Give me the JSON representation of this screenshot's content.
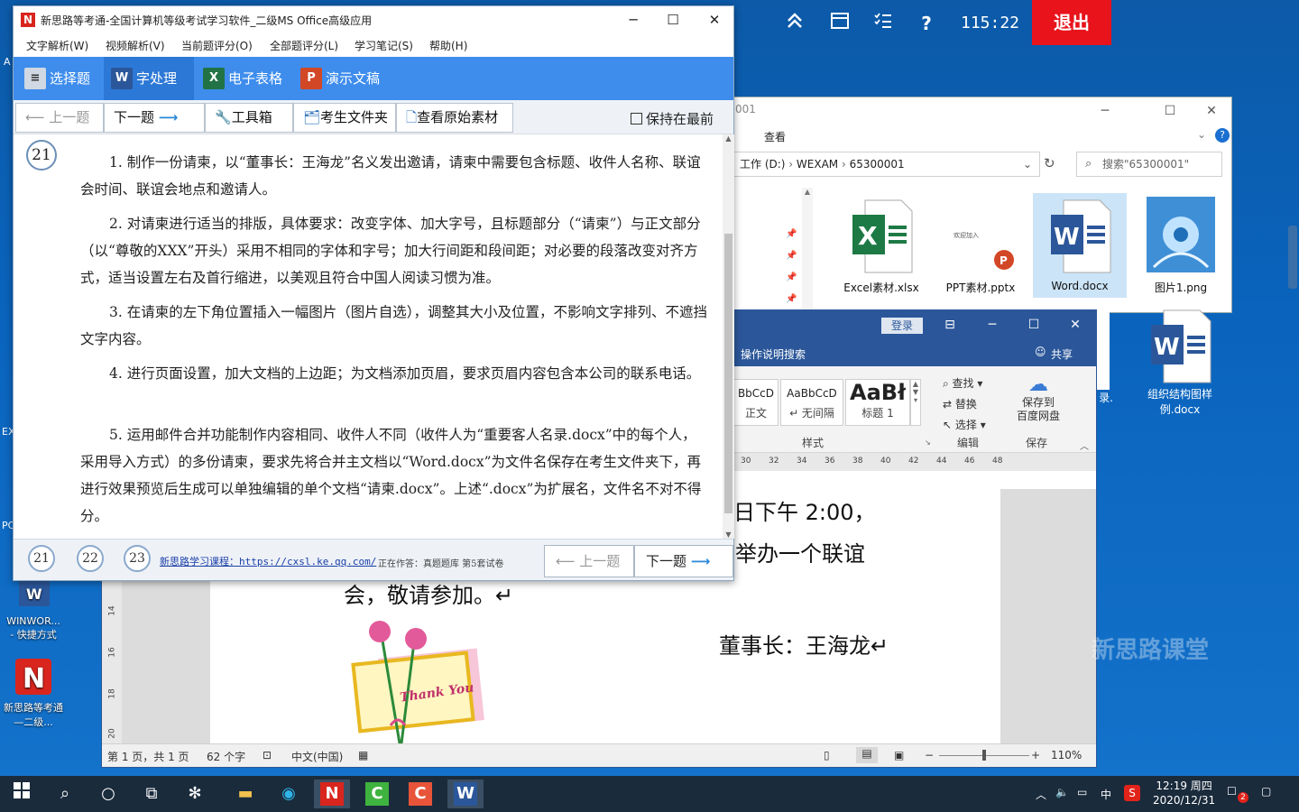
{
  "topbar": {
    "timer": "115:22",
    "exit_label": "退出",
    "help_glyph": "?"
  },
  "desktop": {
    "icons": [
      {
        "label": "WINWOR...\n- 快捷方式"
      },
      {
        "label": "新思路等考通—二级..."
      }
    ],
    "edge_labels": [
      "A",
      "EX",
      "PC"
    ]
  },
  "explorer": {
    "title_partial": "001",
    "ribbon_tab": "查看",
    "breadcrumb": [
      "工作 (D:)",
      "WEXAM",
      "65300001"
    ],
    "search_placeholder": "搜索\"65300001\"",
    "files": [
      {
        "name": "Excel素材.xlsx"
      },
      {
        "name": "PPT素材.pptx",
        "thumb_caption": "欢迎加入"
      },
      {
        "name": "Word.docx"
      },
      {
        "name": "图片1.png"
      }
    ],
    "extra_files": [
      {
        "name": "组织结构图样例.docx"
      },
      {
        "name": "录."
      }
    ]
  },
  "word": {
    "login_label": "登录",
    "tell_me": "操作说明搜索",
    "share_label": "共享",
    "styles": [
      {
        "preview": "BbCcD",
        "name": "正文"
      },
      {
        "preview": "AaBbCcD",
        "name": "↵ 无间隔"
      },
      {
        "preview": "AaBł",
        "name": "标题 1"
      }
    ],
    "styles_group": "样式",
    "edit_items": [
      "查找",
      "替换",
      "选择"
    ],
    "edit_group": "编辑",
    "save_label": "保存到\n百度网盘",
    "save_group": "保存",
    "ruler_marks": [
      "30",
      "32",
      "34",
      "36",
      "38",
      "40",
      "42",
      "44",
      "46",
      "48"
    ],
    "vruler_marks": [
      "14",
      "16",
      "18",
      "20"
    ],
    "doc_lines": [
      "日下午 2:00，",
      "举办一个联谊",
      "会，敬请参加。↵",
      "董事长：王海龙↵"
    ],
    "card_text": "Thank You",
    "status": {
      "page": "第 1 页，共 1 页",
      "words": "62 个字",
      "lang": "中文(中国)",
      "zoom": "110%"
    }
  },
  "exam": {
    "title": "新思路等考通-全国计算机等级考试学习软件_二级MS Office高级应用",
    "menu": [
      "文字解析(W)",
      "视频解析(V)",
      "当前题评分(O)",
      "全部题评分(L)",
      "学习笔记(S)",
      "帮助(H)"
    ],
    "tabs": [
      {
        "label": "选择题",
        "icon": "≡",
        "color": "#cfd8e3"
      },
      {
        "label": "字处理",
        "icon": "W",
        "color": "#2b579a"
      },
      {
        "label": "电子表格",
        "icon": "X",
        "color": "#217346"
      },
      {
        "label": "演示文稿",
        "icon": "P",
        "color": "#d24726"
      }
    ],
    "tools": {
      "prev": "上一题",
      "next": "下一题",
      "toolbox": "工具箱",
      "folder": "考生文件夹",
      "original": "查看原始素材",
      "keep_top": "保持在最前"
    },
    "question_number": "21",
    "paragraphs": [
      "1. 制作一份请柬，以“董事长：王海龙”名义发出邀请，请柬中需要包含标题、收件人名称、联谊会时间、联谊会地点和邀请人。",
      "2. 对请柬进行适当的排版，具体要求：改变字体、加大字号，且标题部分（“请柬”）与正文部分（以“尊敬的XXX”开头）采用不相同的字体和字号；加大行间距和段间距；对必要的段落改变对齐方式，适当设置左右及首行缩进，以美观且符合中国人阅读习惯为准。",
      "3. 在请柬的左下角位置插入一幅图片（图片自选），调整其大小及位置，不影响文字排列、不遮挡文字内容。",
      "4. 进行页面设置，加大文档的上边距；为文档添加页眉，要求页眉内容包含本公司的联系电话。",
      "5. 运用邮件合并功能制作内容相同、收件人不同（收件人为“重要客人名录.docx”中的每个人，采用导入方式）的多份请柬，要求先将合并主文档以“Word.docx”为文件名保存在考生文件夹下，再进行效果预览后生成可以单独编辑的单个文档“请柬.docx”。上述“.docx”为扩展名，文件名不对不得分。"
    ],
    "footer": {
      "pages": [
        "21",
        "22",
        "23"
      ],
      "link": "新思路学习课程：https://cxsl.ke.qq.com/",
      "status": "正在作答：真题题库 第5套试卷",
      "prev": "上一题",
      "next": "下一题"
    }
  },
  "watermark": "新思路课堂",
  "taskbar": {
    "time": "12:19 周四",
    "date": "2020/12/31",
    "ime": "中",
    "notif_count": "2"
  }
}
